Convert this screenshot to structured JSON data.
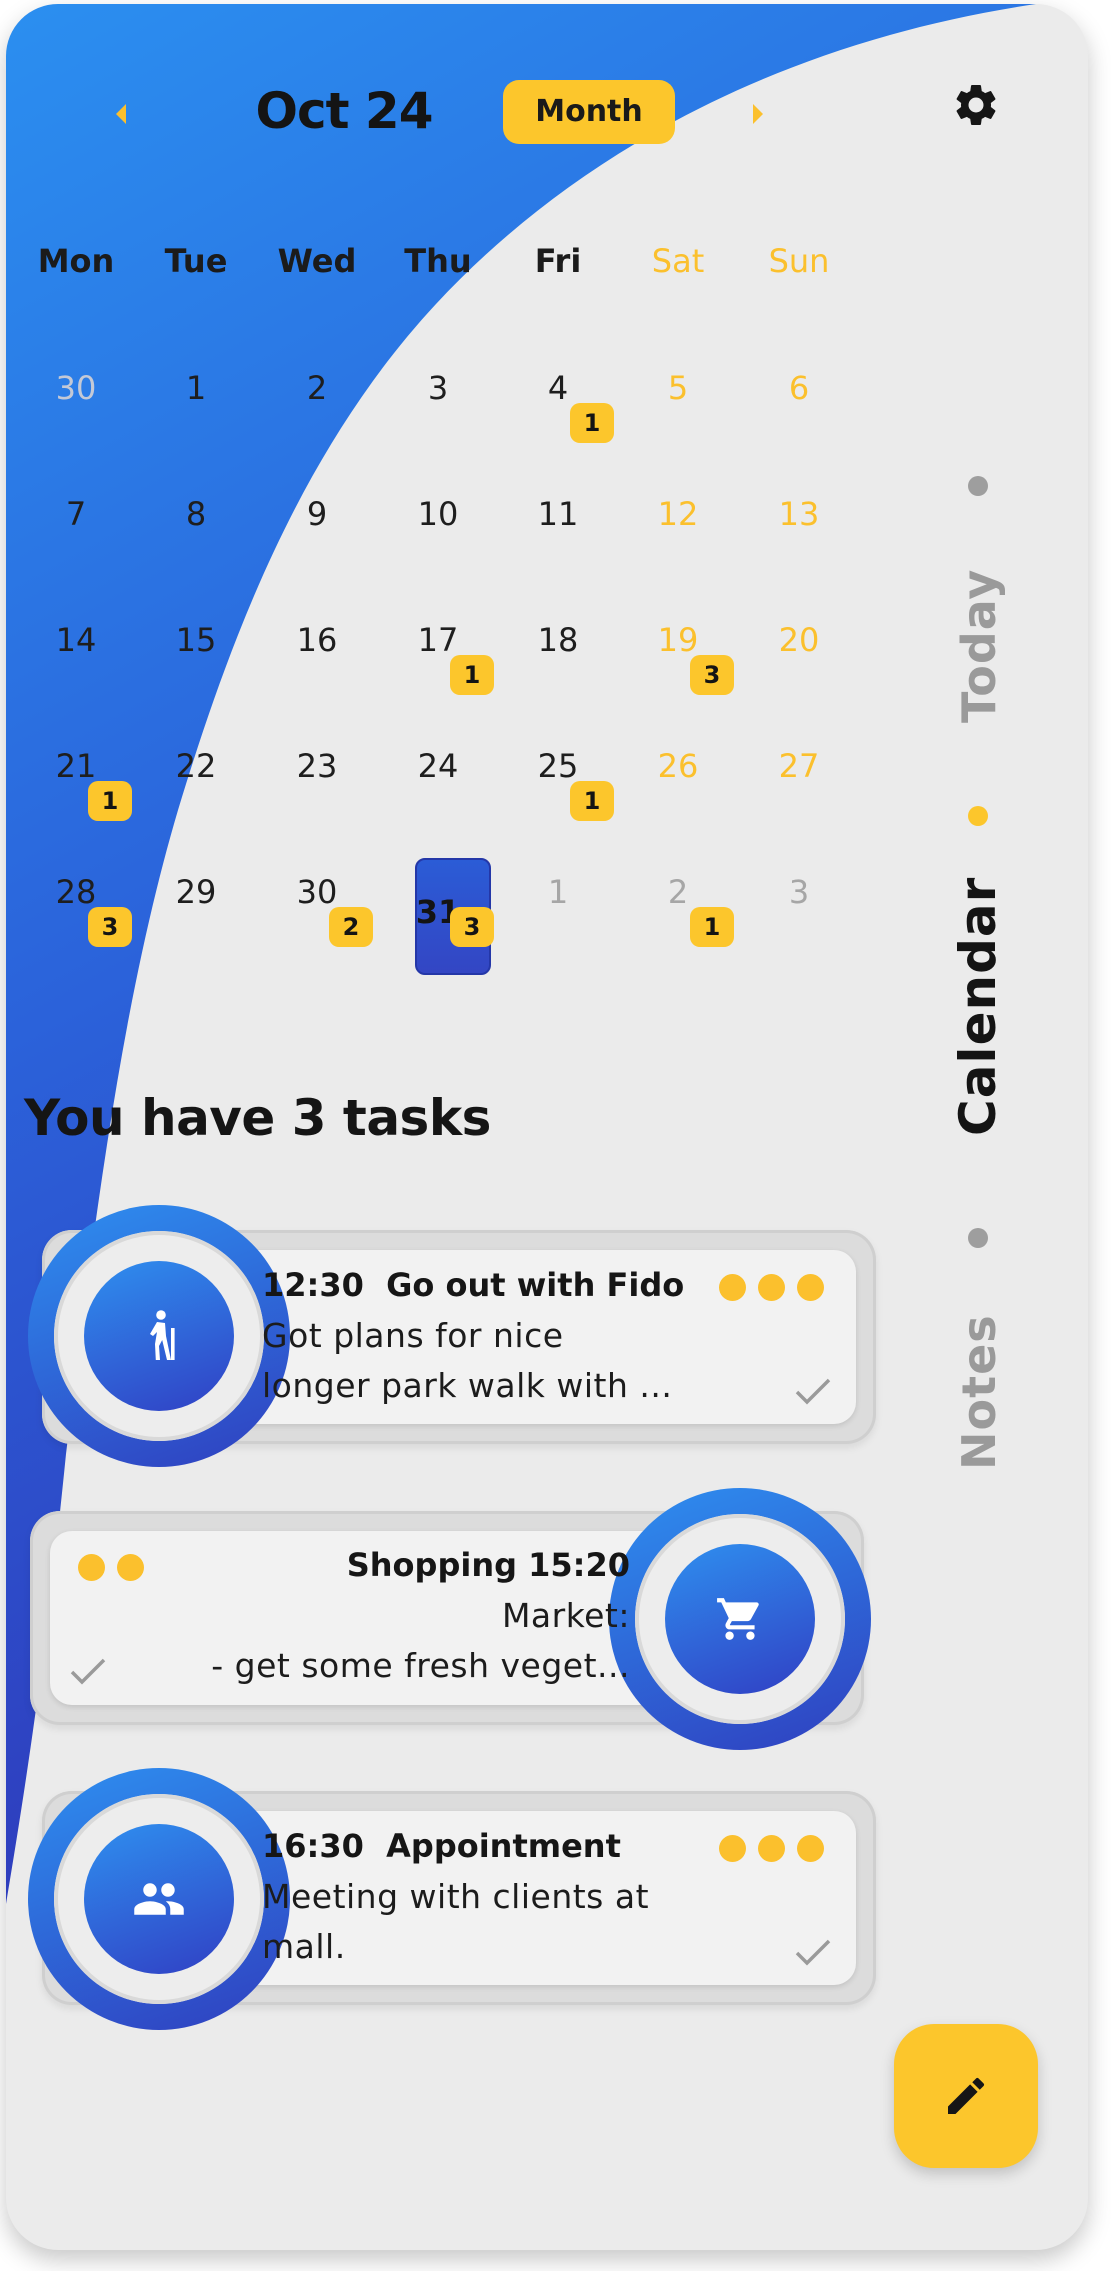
{
  "header": {
    "title": "Oct 24",
    "view_toggle": "Month",
    "prev_icon": "chevron-left-icon",
    "next_icon": "chevron-right-icon",
    "settings_icon": "gear-icon"
  },
  "colors": {
    "primary": "#2e8ff0",
    "primary_dark": "#3040c4",
    "accent": "#fcc62c",
    "background": "#ebebeb"
  },
  "weekdays": [
    "Mon",
    "Tue",
    "Wed",
    "Thu",
    "Fri",
    "Sat",
    "Sun"
  ],
  "calendar": {
    "weeks": [
      [
        {
          "d": "30",
          "muted": true
        },
        {
          "d": "1"
        },
        {
          "d": "2"
        },
        {
          "d": "3"
        },
        {
          "d": "4",
          "badge": "1"
        },
        {
          "d": "5"
        },
        {
          "d": "6"
        }
      ],
      [
        {
          "d": "7"
        },
        {
          "d": "8"
        },
        {
          "d": "9"
        },
        {
          "d": "10"
        },
        {
          "d": "11"
        },
        {
          "d": "12"
        },
        {
          "d": "13"
        }
      ],
      [
        {
          "d": "14"
        },
        {
          "d": "15"
        },
        {
          "d": "16"
        },
        {
          "d": "17",
          "badge": "1"
        },
        {
          "d": "18"
        },
        {
          "d": "19",
          "badge": "3"
        },
        {
          "d": "20"
        }
      ],
      [
        {
          "d": "21",
          "badge": "1"
        },
        {
          "d": "22"
        },
        {
          "d": "23"
        },
        {
          "d": "24"
        },
        {
          "d": "25",
          "badge": "1"
        },
        {
          "d": "26"
        },
        {
          "d": "27"
        }
      ],
      [
        {
          "d": "28",
          "badge": "3"
        },
        {
          "d": "29"
        },
        {
          "d": "30",
          "badge": "2"
        },
        {
          "d": "31",
          "badge": "3",
          "selected": true
        },
        {
          "d": "1",
          "muted": true
        },
        {
          "d": "2",
          "muted": true,
          "badge": "1"
        },
        {
          "d": "3",
          "muted": true
        }
      ]
    ]
  },
  "side_nav": {
    "tabs": [
      {
        "label": "Today",
        "active": false
      },
      {
        "label": "Calendar",
        "active": true
      },
      {
        "label": "Notes",
        "active": false
      }
    ]
  },
  "tasks_title": "You have 3 tasks",
  "tasks": [
    {
      "time": "12:30",
      "title": "Go out with Fido",
      "line1": "Got plans for nice",
      "line2": "longer park walk with ...",
      "dots": 3,
      "icon": "hiking-icon",
      "done": true
    },
    {
      "time": "15:20",
      "title": "Shopping",
      "line1": "Market:",
      "line2": "- get some fresh veget...",
      "dots": 2,
      "icon": "shopping-cart-icon",
      "done": true
    },
    {
      "time": "16:30",
      "title": "Appointment",
      "line1": "Meeting with clients at",
      "line2": "mall.",
      "dots": 3,
      "icon": "people-icon",
      "done": true
    }
  ],
  "fab": {
    "icon": "pencil-icon"
  }
}
